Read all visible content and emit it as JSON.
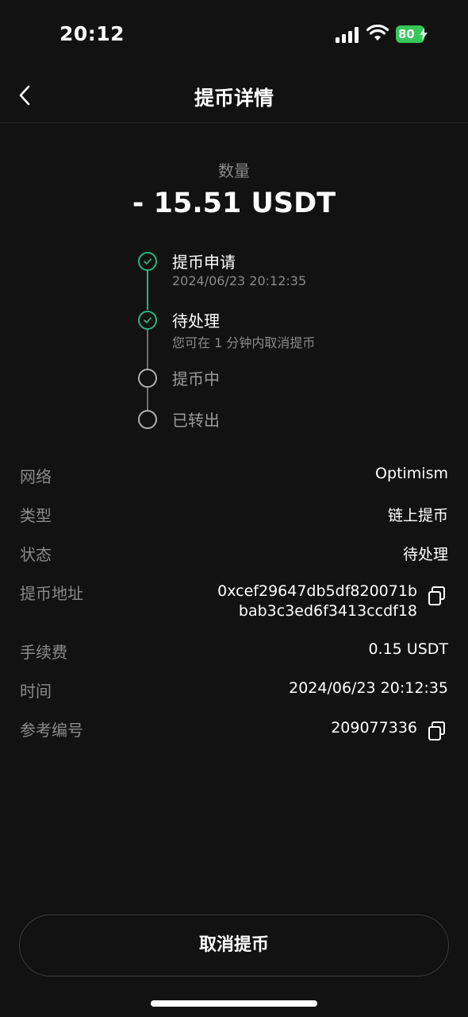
{
  "status_bar": {
    "time": "20:12",
    "battery": "80"
  },
  "header": {
    "title": "提币详情"
  },
  "amount": {
    "label": "数量",
    "value": "- 15.51 USDT"
  },
  "timeline": [
    {
      "title": "提币申请",
      "subtitle": "2024/06/23 20:12:35",
      "status": "done"
    },
    {
      "title": "待处理",
      "subtitle": "您可在 1 分钟内取消提币",
      "status": "done"
    },
    {
      "title": "提币中",
      "subtitle": "",
      "status": "pending"
    },
    {
      "title": "已转出",
      "subtitle": "",
      "status": "pending"
    }
  ],
  "details": {
    "network": {
      "label": "网络",
      "value": "Optimism"
    },
    "type": {
      "label": "类型",
      "value": "链上提币"
    },
    "status": {
      "label": "状态",
      "value": "待处理"
    },
    "address": {
      "label": "提币地址",
      "line1": "0xcef29647db5df820071b",
      "line2": "bab3c3ed6f3413ccdf18"
    },
    "fee": {
      "label": "手续费",
      "value": "0.15 USDT"
    },
    "time": {
      "label": "时间",
      "value": "2024/06/23 20:12:35"
    },
    "reference": {
      "label": "参考编号",
      "value": "209077336"
    }
  },
  "actions": {
    "cancel_label": "取消提币"
  },
  "colors": {
    "background": "#121212",
    "accent_green": "#2bb37e",
    "muted_text": "#8a8a8a",
    "battery_green": "#34c759"
  }
}
